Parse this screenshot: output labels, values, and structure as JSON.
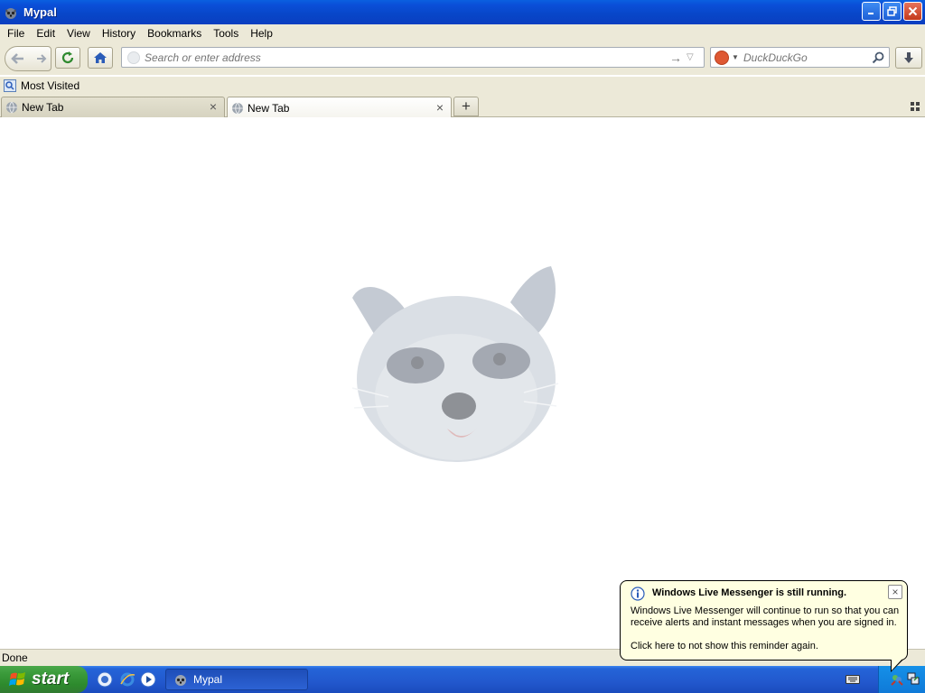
{
  "window": {
    "title": "Mypal"
  },
  "menu": [
    "File",
    "Edit",
    "View",
    "History",
    "Bookmarks",
    "Tools",
    "Help"
  ],
  "navbar": {
    "url_placeholder": "Search or enter address",
    "search_placeholder": "DuckDuckGo"
  },
  "bookmarks": {
    "most_visited": "Most Visited"
  },
  "tabs": [
    {
      "label": "New Tab",
      "active": false
    },
    {
      "label": "New Tab",
      "active": true
    }
  ],
  "statusbar": {
    "text": "Done"
  },
  "taskbar": {
    "start_label": "start",
    "task_label": "Mypal"
  },
  "balloon": {
    "title": "Windows Live Messenger is still running.",
    "body": "Windows Live Messenger will continue to run so that you can receive alerts and instant messages when you are signed in.",
    "link": "Click here to not show this reminder again."
  },
  "colors": {
    "titlebar": "#0a4fd8",
    "chrome": "#ece9d8",
    "taskbar": "#2258cd",
    "start": "#3a9a3a",
    "balloon": "#ffffe1"
  }
}
